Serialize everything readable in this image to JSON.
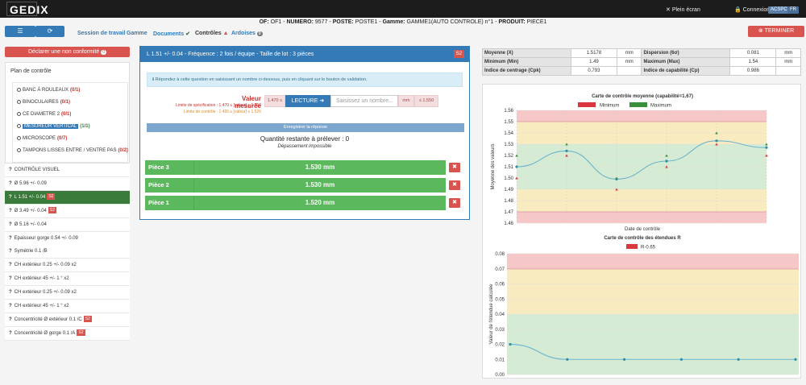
{
  "header": {
    "logo": "GEDIX",
    "fullscreen": "Plein écran",
    "connexion": "Connexion",
    "badge1": "ACSPC",
    "badge2": "FR",
    "of_label": "OF:",
    "of_value": "OF1",
    "numero_label": "NUMERO:",
    "numero_value": "9577",
    "poste_label": "POSTE:",
    "poste_value": "POSTE1",
    "gamme_label": "Gamme:",
    "gamme_value": "GAMME1(AUTO CONTROLE) n°1",
    "produit_label": "PRODUIT:",
    "produit_value": "PIECE1"
  },
  "toolbar": {
    "nav": [
      "Session de travail",
      "Gamme",
      "Documents",
      "Contrôles",
      "Ardoises"
    ],
    "ardoises_count": "0",
    "terminer": "TERMINER"
  },
  "left": {
    "declare": "Déclarer une non conformité",
    "declare_count": "0",
    "plan_title": "Plan de contrôle",
    "plan_items": [
      {
        "label": "BANC À ROULEAUX",
        "count": "(0/1)"
      },
      {
        "label": "BINOCULAIRES",
        "count": "(0/1)"
      },
      {
        "label": "CE DIAMETRE 2",
        "count": "(0/1)"
      },
      {
        "label": "MESUREUR VERTICAL",
        "count": "(1/1)"
      },
      {
        "label": "MICROSCOPE",
        "count": "(0/7)"
      },
      {
        "label": "TAMPONS LISSES ENTRE / VENTRE PAS",
        "count": "(0/2)"
      }
    ],
    "controls": [
      {
        "label": "CONTRÔLE VISUEL",
        "s2": ""
      },
      {
        "label": "Ø 5.96 +/- 0.09",
        "s2": ""
      },
      {
        "label": "L 1.51 +/- 0.04",
        "s2": "S2"
      },
      {
        "label": "Ø 3.49 +/- 0.04",
        "s2": "S2"
      },
      {
        "label": "Ø 5.16 +/- 0.04",
        "s2": ""
      },
      {
        "label": "Epaisseur gorge 0.54 +/- 0.09",
        "s2": ""
      },
      {
        "label": "Symétrie 0.1 /B",
        "s2": ""
      },
      {
        "label": "CH extérieur 0.25 +/- 0.09 x2",
        "s2": ""
      },
      {
        "label": "CH extérieur 45 +/- 1 ° x2",
        "s2": ""
      },
      {
        "label": "CH extérieur 0.25 +/- 0.09 x2",
        "s2": ""
      },
      {
        "label": "CH extérieur 45 +/- 1 ° x2",
        "s2": ""
      },
      {
        "label": "Concentricité Ø extérieur 0.1 /C",
        "s2": "S2"
      },
      {
        "label": "Concentricité Ø gorge 0.1 /A",
        "s2": "S2"
      }
    ]
  },
  "center": {
    "title": "L 1.51 +/- 0.04 - Fréquence : 2 fois / équipe - Taille de lot : 3 pièces",
    "s2": "S2",
    "info": "Répondez à cette question en saisissant un nombre ci-dessous, puis en cliquant sur le bouton de validation.",
    "vm_title": "Valeur mesurée",
    "vm_spec": "Limite de spécification : 1.470 ≤ [valeur] ≤ 1.550",
    "vm_ctrl": "Limite de contrôle : 1.495 ≤ [valeur] ≤ 1.526",
    "min_label": "1.470 ≤",
    "lecture": "LECTURE",
    "saisie_placeholder": "Saisissez un nombre...",
    "unit": "mm",
    "max_label": "≤ 1.550",
    "enregistrer": "Enregistrer la réponse",
    "quantite": "Quantité restante à prélever : 0",
    "depassement": "Dépassement impossible",
    "pieces": [
      {
        "label": "Pièce 3",
        "value": "1.530 mm"
      },
      {
        "label": "Pièce 2",
        "value": "1.530 mm"
      },
      {
        "label": "Pièce 1",
        "value": "1.520 mm"
      }
    ]
  },
  "stats": {
    "rows": [
      [
        "Moyenne (X)",
        "1.5178",
        "mm",
        "Dispersion (6σ)",
        "0.081",
        "mm"
      ],
      [
        "Minimum (Min)",
        "1.49",
        "mm",
        "Maximum (Max)",
        "1.54",
        "mm"
      ],
      [
        "Indice de centrage (Cpk)",
        "0.793",
        "",
        "Indice de capabilité (Cp)",
        "0.986",
        ""
      ]
    ]
  },
  "chart_data": [
    {
      "type": "line",
      "title": "Carte de contrôle moyenne (capabilité=1.67)",
      "xlabel": "Date de contrôle",
      "ylabel": "Moyenne des valeurs",
      "legend": [
        "Minimum",
        "Maximum"
      ],
      "ylim": [
        1.46,
        1.56
      ],
      "yticks": [
        1.46,
        1.47,
        1.48,
        1.49,
        1.5,
        1.51,
        1.52,
        1.53,
        1.54,
        1.55,
        1.56
      ],
      "series": [
        {
          "values": [
            1.51,
            1.524,
            1.499,
            1.515,
            1.533,
            1.527
          ]
        }
      ],
      "min_values": [
        1.5,
        1.52,
        1.49,
        1.51,
        1.53,
        1.52
      ],
      "max_values": [
        1.52,
        1.53,
        1.5,
        1.52,
        1.54,
        1.53
      ]
    },
    {
      "type": "line",
      "title": "Carte de contrôle des étendues R",
      "ylabel": "Valeur de l'étendue calculée",
      "legend": [
        "R-0.65"
      ],
      "ylim": [
        0,
        0.08
      ],
      "yticks": [
        0,
        0.01,
        0.02,
        0.03,
        0.04,
        0.05,
        0.06,
        0.07,
        0.08
      ],
      "series": [
        {
          "values": [
            0.02,
            0.01,
            0.01,
            0.01,
            0.01,
            0.01
          ]
        }
      ]
    }
  ],
  "colors": {
    "primary": "#337ab7",
    "danger": "#d9534f",
    "success": "#5cb85c",
    "zone_red": "#f6c7c7",
    "zone_yellow": "#f9ebc0",
    "zone_green": "#d6ebd3"
  }
}
